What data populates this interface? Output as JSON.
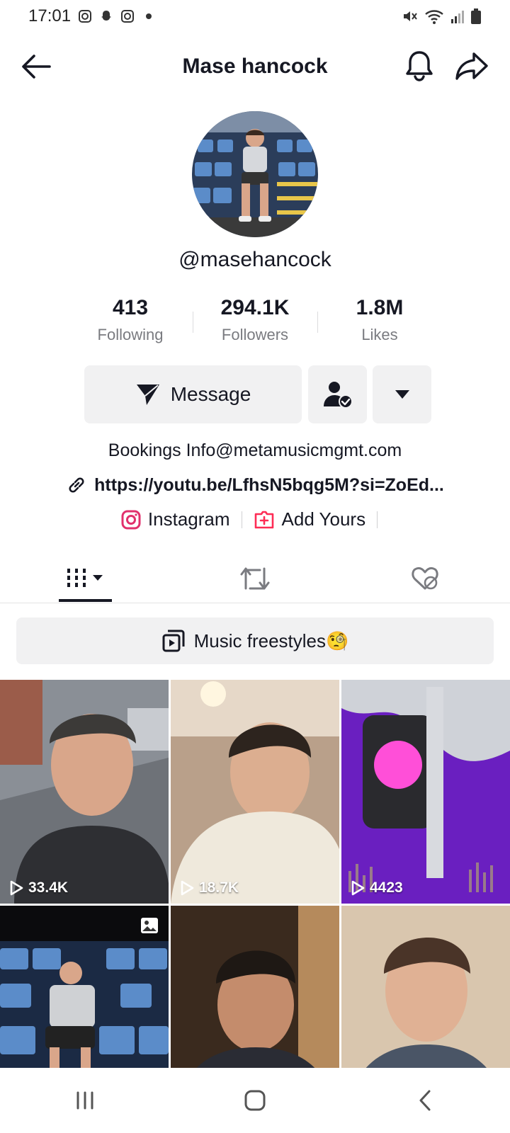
{
  "status_bar": {
    "time": "17:01",
    "left_icons": [
      "instagram-icon",
      "snapchat-icon",
      "instagram-icon",
      "dot-icon"
    ],
    "right_icons": [
      "mute-icon",
      "wifi-icon",
      "signal-icon",
      "battery-icon"
    ]
  },
  "header": {
    "title": "Mase hancock",
    "icons": [
      "back-arrow-icon",
      "bell-icon",
      "share-icon"
    ]
  },
  "profile": {
    "username": "@masehancock",
    "stats": [
      {
        "value": "413",
        "label": "Following"
      },
      {
        "value": "294.1K",
        "label": "Followers"
      },
      {
        "value": "1.8M",
        "label": "Likes"
      }
    ]
  },
  "actions": {
    "message_label": "Message",
    "following_icon": "user-check-icon",
    "more_icon": "caret-down-icon"
  },
  "bio": {
    "text": "Bookings Info@metamusicmgmt.com",
    "link": "https://youtu.be/LfhsN5bqg5M?si=ZoEd...",
    "social": [
      {
        "icon": "instagram-icon",
        "label": "Instagram"
      },
      {
        "icon": "add-yours-icon",
        "label": "Add Yours"
      }
    ]
  },
  "tabs": {
    "icons": [
      "videos-grid-icon",
      "repost-icon",
      "liked-hidden-icon"
    ],
    "active_index": 0
  },
  "playlist": {
    "label": "Music freestyles🧐"
  },
  "videos": [
    {
      "views": "33.4K"
    },
    {
      "views": "18.7K"
    },
    {
      "views": "4423"
    },
    {
      "views": ""
    },
    {
      "views": ""
    },
    {
      "views": ""
    }
  ],
  "navbar": {
    "icons": [
      "recent-apps-icon",
      "home-icon",
      "back-icon"
    ]
  },
  "colors": {
    "accent": "#161823",
    "button_bg": "#f1f1f2",
    "secondary_text": "#7a7b80",
    "instagram": "#e1306c",
    "add_yours": "#fe2c55"
  }
}
